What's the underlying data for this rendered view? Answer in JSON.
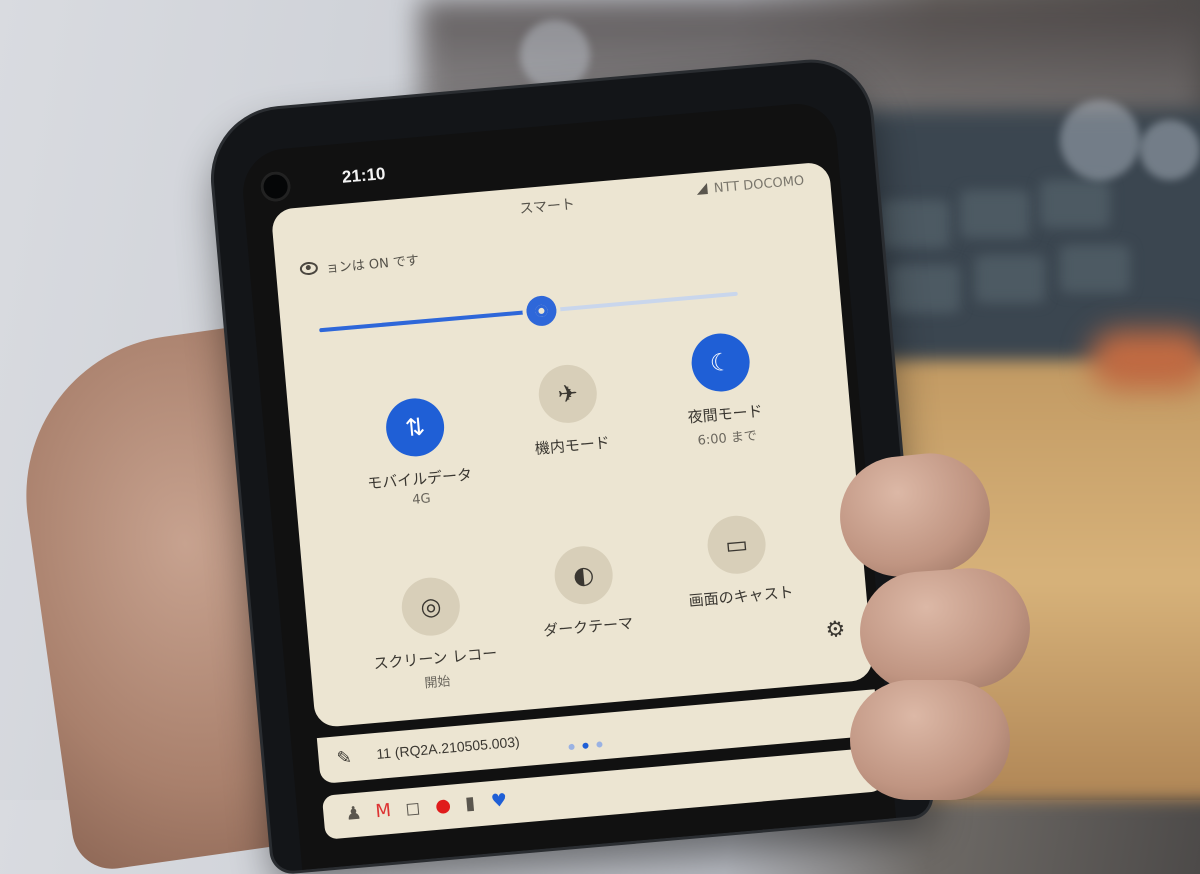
{
  "status": {
    "time": "21:10",
    "carrier": "NTT DOCOMO"
  },
  "header": {
    "mode": "スマート",
    "notice": "ョンは ON です"
  },
  "brightness": {
    "level": 0.53
  },
  "tiles": [
    {
      "label": "モバイルデータ",
      "sub": "4G",
      "icon": "mobile-data-icon",
      "active": true
    },
    {
      "label": "機内モード",
      "sub": "",
      "icon": "airplane-icon",
      "active": false
    },
    {
      "label": "夜間モード",
      "sub": "6:00 まで",
      "icon": "moon-icon",
      "active": true
    },
    {
      "label": "スクリーン レコー",
      "sub": "開始",
      "icon": "screen-record-icon",
      "active": false
    },
    {
      "label": "ダークテーマ",
      "sub": "",
      "icon": "dark-theme-icon",
      "active": false
    },
    {
      "label": "画面のキャスト",
      "sub": "",
      "icon": "cast-icon",
      "active": false
    }
  ],
  "footer": {
    "build": "11 (RQ2A.210505.003)",
    "page_dots": 3,
    "active_dot": 1
  },
  "colors": {
    "accent": "#1f5fd6",
    "panel": "#ece5d2"
  }
}
